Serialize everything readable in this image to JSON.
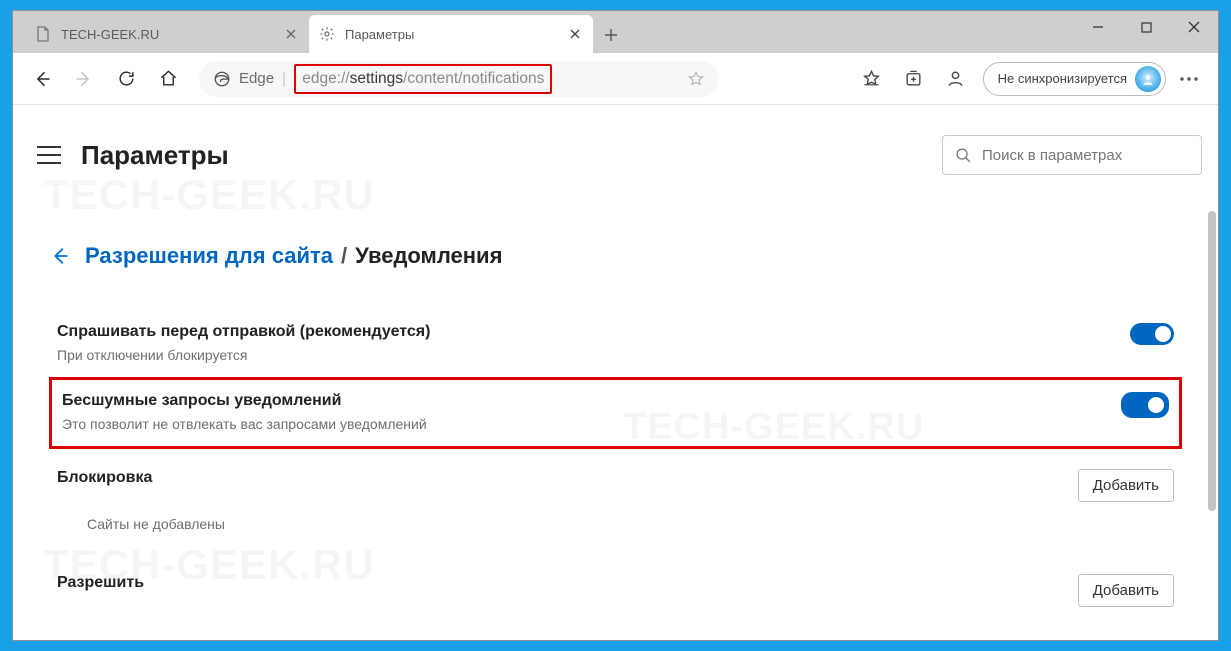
{
  "watermark": "TECH-GEEK.RU",
  "tabs": [
    {
      "title": "TECH-GEEK.RU",
      "active": false
    },
    {
      "title": "Параметры",
      "active": true
    }
  ],
  "addressbar": {
    "brand": "Edge",
    "url_scheme": "edge://",
    "url_host": "settings",
    "url_path": "/content/notifications"
  },
  "sync_label": "Не синхронизируется",
  "settings": {
    "page_title": "Параметры",
    "search_placeholder": "Поиск в параметрах",
    "breadcrumb_parent": "Разрешения для сайта",
    "breadcrumb_current": "Уведомления",
    "rows": {
      "ask": {
        "label": "Спрашивать перед отправкой (рекомендуется)",
        "desc": "При отключении блокируется"
      },
      "silent": {
        "label": "Бесшумные запросы уведомлений",
        "desc": "Это позволит не отвлекать вас запросами уведомлений"
      },
      "block": {
        "label": "Блокировка",
        "empty": "Сайты не добавлены",
        "button": "Добавить"
      },
      "allow": {
        "label": "Разрешить",
        "button": "Добавить"
      }
    }
  }
}
